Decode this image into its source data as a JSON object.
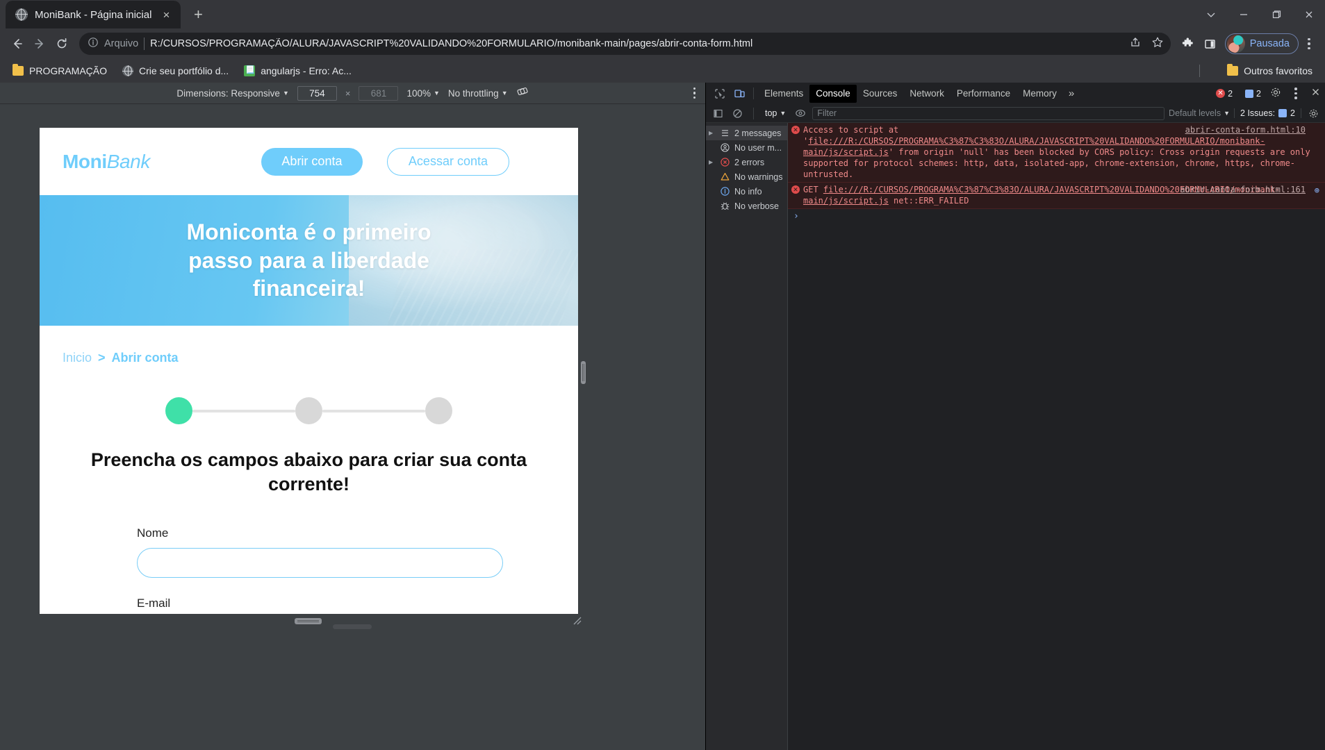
{
  "browser": {
    "tab": {
      "title": "MoniBank - Página inicial",
      "favicon": "globe-icon",
      "close": "×"
    },
    "newtab_label": "+",
    "window_controls": {
      "minimize": "—",
      "maximize": "▢",
      "close": "✕",
      "more": "⌄"
    },
    "nav": {
      "back": "←",
      "forward": "→",
      "reload": "⟳"
    },
    "omnibox": {
      "scheme_label": "Arquivo",
      "url": "R:/CURSOS/PROGRAMAÇÃO/ALURA/JAVASCRIPT%20VALIDANDO%20FORMULARIO/monibank-main/pages/abrir-conta-form.html",
      "info_icon": "info-circle-icon",
      "share_icon": "share-icon",
      "bookmark_icon": "star-icon"
    },
    "toolbar": {
      "extensions_icon": "puzzle-icon",
      "sidepanel_icon": "side-panel-icon",
      "profile_label": "Pausada",
      "menu_icon": "kebab-menu-icon"
    },
    "bookmarks": [
      {
        "label": "PROGRAMAÇÃO",
        "icon": "folder-icon"
      },
      {
        "label": "Crie seu portfólio d...",
        "icon": "globe-icon"
      },
      {
        "label": "angularjs - Erro: Ac...",
        "icon": "page-icon"
      }
    ],
    "bookmarks_right": {
      "label": "Outros favoritos",
      "icon": "folder-icon"
    }
  },
  "device_toolbar": {
    "dimensions_label": "Dimensions: Responsive",
    "width": "754",
    "height_placeholder": "681",
    "times": "×",
    "zoom": "100%",
    "throttling": "No throttling",
    "rotate_icon": "rotate-icon",
    "menu_icon": "kebab-menu-icon"
  },
  "page": {
    "logo": {
      "bold": "Moni",
      "italic": "Bank"
    },
    "header_buttons": {
      "primary": "Abrir conta",
      "secondary": "Acessar conta"
    },
    "hero_title": "Moniconta é o primeiro passo para a liberdade financeira!",
    "breadcrumb": {
      "home": "Inicio",
      "separator": ">",
      "current": "Abrir conta"
    },
    "stepper": {
      "steps": 3,
      "active_index": 0
    },
    "form_title": "Preencha os campos abaixo para criar sua conta corrente!",
    "fields": [
      {
        "label": "Nome",
        "value": ""
      },
      {
        "label": "E-mail",
        "value": ""
      }
    ],
    "colors": {
      "brand": "#6fcdfb",
      "accent_green": "#3fe0a8",
      "hero_from": "#56bdf0",
      "hero_to": "#c5e2ec"
    }
  },
  "devtools": {
    "tabs": [
      "Elements",
      "Console",
      "Sources",
      "Network",
      "Performance",
      "Memory"
    ],
    "selected_tab": "Console",
    "more_tabs_icon": "chevron-double-right-icon",
    "inspect_icon": "inspect-icon",
    "device_icon": "device-toolbar-icon",
    "error_count": "2",
    "message_count": "2",
    "settings_icon": "gear-icon",
    "menu_icon": "kebab-menu-icon",
    "close_icon": "close-icon",
    "console_toolbar": {
      "sidebar_icon": "show-console-sidebar-icon",
      "clear_icon": "clear-console-icon",
      "context": "top",
      "eye_icon": "live-expression-icon",
      "filter_placeholder": "Filter",
      "levels": "Default levels",
      "issues_label": "2 Issues:",
      "issues_count": "2",
      "settings_icon": "gear-icon"
    },
    "sidebar": [
      {
        "label": "2 messages",
        "icon": "list-icon",
        "expandable": true,
        "selected": true
      },
      {
        "label": "No user m...",
        "icon": "user-icon",
        "expandable": false,
        "selected": false
      },
      {
        "label": "2 errors",
        "icon": "error-icon",
        "expandable": true,
        "selected": false
      },
      {
        "label": "No warnings",
        "icon": "warning-icon",
        "expandable": false,
        "selected": false
      },
      {
        "label": "No info",
        "icon": "info-icon",
        "expandable": false,
        "selected": false
      },
      {
        "label": "No verbose",
        "icon": "bug-icon",
        "expandable": false,
        "selected": false
      }
    ],
    "messages": [
      {
        "icon": "error-icon",
        "text_prefix": "Access to script at '",
        "link": "file:///R:/CURSOS/PROGRAMA%C3%87%C3%83O/ALURA/JAVASCRIPT%20VALIDANDO%20FORMULARIO/monibank-main/js/script.js",
        "text_suffix": "' from origin 'null' has been blocked by CORS policy: Cross origin requests are only supported for protocol schemes: http, data, isolated-app, chrome-extension, chrome, https, chrome-untrusted.",
        "source": "abrir-conta-form.html:10"
      },
      {
        "icon": "error-icon",
        "text_prefix": "GET ",
        "link": "file:///R:/CURSOS/PROGRAMA%C3%87%C3%83O/ALURA/JAVASCRIPT%20VALIDANDO%20FORMULARIO/monibank-main/js/script.js",
        "text_suffix": " net::ERR_FAILED",
        "source": "abrir-conta-form.html:161",
        "extra_icon": "request-blocked-icon"
      }
    ],
    "prompt": "›"
  }
}
